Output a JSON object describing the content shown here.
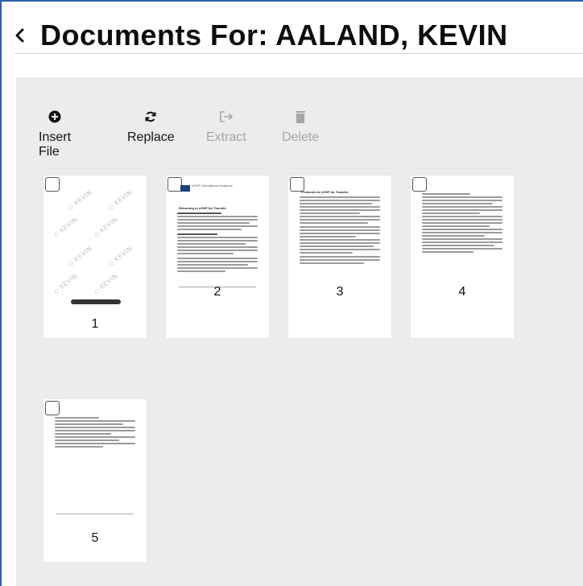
{
  "page": {
    "title": "Documents For: AALAND, KEVIN"
  },
  "toolbar": {
    "insert_label": "Insert File",
    "replace_label": "Replace",
    "extract_label": "Extract",
    "delete_label": "Delete",
    "icons": {
      "insert": "plus-circle-icon",
      "replace": "refresh-icon",
      "extract": "export-icon",
      "delete": "trash-icon"
    }
  },
  "pages": [
    {
      "number": "1",
      "watermark": "KEVIN"
    },
    {
      "number": "2",
      "header_title": "eOHP Operational Guidance",
      "section": "Returning to eOHP for Transfer"
    },
    {
      "number": "3",
      "section": "Protocols to eOHP for Transfer"
    },
    {
      "number": "4"
    },
    {
      "number": "5"
    }
  ],
  "colors": {
    "frame_accent": "#2f5da8",
    "panel_bg": "#ececec",
    "disabled_text": "#a6a6a6"
  }
}
